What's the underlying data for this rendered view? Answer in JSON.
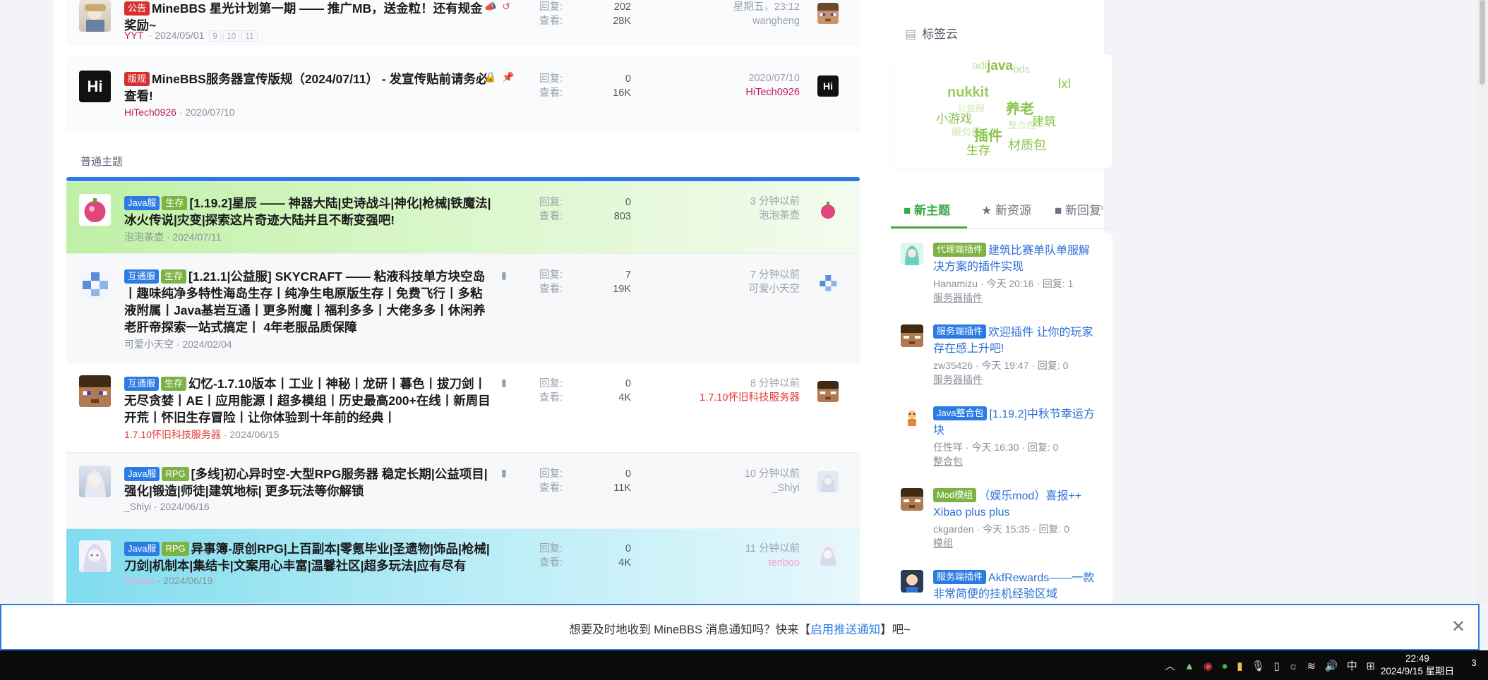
{
  "threads_sticky": [
    {
      "prefix": "公告",
      "prefix_color": "#d63031",
      "title": "MineBBS 星光计划第一期 —— 推广MB，送金粒！还有规金奖励~",
      "author": "YYT",
      "date": "2024/05/01",
      "pages": [
        "9",
        "10",
        "11"
      ],
      "replies_label": "回复:",
      "replies": "202",
      "views_label": "查看:",
      "views": "28K",
      "last_time": "星期五，23:12",
      "last_user": "wangheng"
    },
    {
      "prefix": "版规",
      "prefix_color": "#d63031",
      "title": "MineBBS服务器宣传版规（2024/07/11） - 发宣传贴前请务必查看!",
      "author": "HiTech0926",
      "author_color": "#c2185b",
      "date": "2020/07/10",
      "replies_label": "回复:",
      "replies": "0",
      "views_label": "查看:",
      "views": "16K",
      "last_time": "2020/07/10",
      "last_user": "HiTech0926",
      "avatar_text": "Hi"
    }
  ],
  "section_label": "普通主题",
  "threads": [
    {
      "tags": [
        {
          "text": "Java服",
          "color": "#2c7be5"
        },
        {
          "text": "生存",
          "color": "#7cb342"
        }
      ],
      "title": "[1.19.2]星辰 —— 神器大陆|史诗战斗|神化|枪械|铁魔法|冰火传说|灾变|探索这片奇迹大陆并且不断变强吧!",
      "author": "泡泡茶壶",
      "date": "2024/07/11",
      "replies_label": "回复:",
      "replies": "0",
      "views_label": "查看:",
      "views": "803",
      "last_time": "3 分钟以前",
      "last_user": "泡泡茶壶"
    },
    {
      "tags": [
        {
          "text": "互通服",
          "color": "#2c7be5"
        },
        {
          "text": "生存",
          "color": "#7cb342"
        }
      ],
      "title": "[1.21.1|公益服] SKYCRAFT —— 粘液科技单方块空岛丨趣味纯净多特性海岛生存丨纯净生电原版生存丨免费飞行丨多粘液附属丨Java基岩互通丨更多附魔丨福利多多丨大佬多多丨休闲养老肝帝探索一站式搞定丨 4年老服品质保障",
      "author": "可爱小天空",
      "date": "2024/02/04",
      "replies_label": "回复:",
      "replies": "7",
      "views_label": "查看:",
      "views": "19K",
      "last_time": "7 分钟以前",
      "last_user": "可爱小天空"
    },
    {
      "tags": [
        {
          "text": "互通服",
          "color": "#2c7be5"
        },
        {
          "text": "生存",
          "color": "#7cb342"
        }
      ],
      "title": "幻忆-1.7.10版本丨工业丨神秘丨龙研丨暮色丨拔刀剑丨无尽贪婪丨AE丨应用能源丨超多模组丨历史最高200+在线丨新周目开荒丨怀旧生存冒险丨让你体验到十年前的经典丨",
      "author": "1.7.10怀旧科技服务器",
      "author_color": "#e53935",
      "date": "2024/06/15",
      "replies_label": "回复:",
      "replies": "0",
      "views_label": "查看:",
      "views": "4K",
      "last_time": "8 分钟以前",
      "last_user": "1.7.10怀旧科技服务器"
    },
    {
      "tags": [
        {
          "text": "Java服",
          "color": "#2c7be5"
        },
        {
          "text": "RPG",
          "color": "#7cb342"
        }
      ],
      "title": "[多线]初心异时空-大型RPG服务器 稳定长期|公益项目|强化|锻造|师徒|建筑地标| 更多玩法等你解锁",
      "author": "_Shiyi",
      "date": "2024/06/16",
      "replies_label": "回复:",
      "replies": "0",
      "views_label": "查看:",
      "views": "11K",
      "last_time": "10 分钟以前",
      "last_user": "_Shiyi"
    },
    {
      "tags": [
        {
          "text": "Java服",
          "color": "#2c7be5"
        },
        {
          "text": "RPG",
          "color": "#7cb342"
        }
      ],
      "title": "异事簿-原创RPG|上百副本|零氪毕业|圣遗物|饰品|枪械|刀剑|机制本|集结卡|文案用心丰富|温馨社区|超多玩法|应有尽有",
      "author": "tenboo",
      "date": "2024/06/19",
      "replies_label": "回复:",
      "replies": "0",
      "views_label": "查看:",
      "views": "4K",
      "last_time": "11 分钟以前",
      "last_user": "tenboo"
    }
  ],
  "sidebar": {
    "tagcloud_title": "标签云",
    "tags": [
      "adi",
      "java",
      "bds",
      "nukkit",
      "lxl",
      "养老",
      "小游戏",
      "建筑",
      "插件",
      "生存",
      "材质包",
      "服务器",
      "公益服",
      "整合包"
    ],
    "tabs": [
      {
        "label": "新主题",
        "icon": "comment-icon"
      },
      {
        "label": "新资源",
        "icon": "star-icon"
      },
      {
        "label": "新回复",
        "icon": "comments-icon"
      }
    ],
    "new_threads": [
      {
        "tag": "代理端插件",
        "tag_color": "#7cb342",
        "title": "建筑比赛单队单服解决方案的插件实现",
        "author": "Hanamizu",
        "time": "今天 20:16",
        "replies_label": "回复:",
        "replies": "1",
        "category": "服务器插件"
      },
      {
        "tag": "服务端插件",
        "tag_color": "#2c7be5",
        "title": "欢迎插件 让你的玩家存在感上升吧!",
        "author": "zw35426",
        "time": "今天 19:47",
        "replies_label": "回复:",
        "replies": "0",
        "category": "服务器插件"
      },
      {
        "tag": "Java整合包",
        "tag_color": "#2c7be5",
        "title": "[1.19.2]中秋节幸运方块",
        "author": "任性咩",
        "time": "今天 16:30",
        "replies_label": "回复:",
        "replies": "0",
        "category": "整合包"
      },
      {
        "tag": "Mod模组",
        "tag_color": "#7cb342",
        "title": "（娱乐mod）喜报++ Xibao plus plus",
        "author": "ckgarden",
        "time": "今天 15:35",
        "replies_label": "回复:",
        "replies": "0",
        "category": "模组"
      },
      {
        "tag": "服务端插件",
        "tag_color": "#2c7be5",
        "title": "AkfRewards——一款非常简便的挂机经验区域",
        "author": "",
        "time": "",
        "replies_label": "",
        "replies": "",
        "category": ""
      }
    ]
  },
  "notification": {
    "before": "想要及时地收到 MineBBS 消息通知吗？快来【",
    "link": "启用推送通知",
    "after": "】吧~"
  },
  "taskbar": {
    "ime": "中",
    "time": "22:49",
    "date": "2024/9/15 星期日",
    "notif_count": "3"
  }
}
